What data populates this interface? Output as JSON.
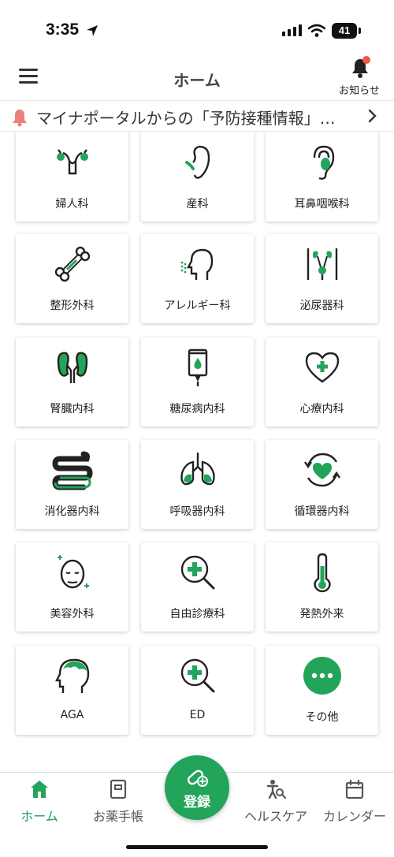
{
  "status": {
    "time": "3:35",
    "battery": "41"
  },
  "header": {
    "title": "ホーム",
    "notifications_label": "お知らせ"
  },
  "announcement": {
    "text": "マイナポータルからの「予防接種情報」…"
  },
  "categories": [
    {
      "label": "婦人科",
      "icon": "uterus-icon"
    },
    {
      "label": "産科",
      "icon": "fetus-icon"
    },
    {
      "label": "耳鼻咽喉科",
      "icon": "ear-icon"
    },
    {
      "label": "整形外科",
      "icon": "bone-icon"
    },
    {
      "label": "アレルギー科",
      "icon": "allergy-head-icon"
    },
    {
      "label": "泌尿器科",
      "icon": "kidney-bladder-icon"
    },
    {
      "label": "腎臓内科",
      "icon": "kidneys-icon"
    },
    {
      "label": "糖尿病内科",
      "icon": "iv-drip-icon"
    },
    {
      "label": "心療内科",
      "icon": "heart-cross-icon"
    },
    {
      "label": "消化器内科",
      "icon": "intestine-icon"
    },
    {
      "label": "呼吸器内科",
      "icon": "lungs-icon"
    },
    {
      "label": "循環器内科",
      "icon": "heart-circulation-icon"
    },
    {
      "label": "美容外科",
      "icon": "face-sparkle-icon"
    },
    {
      "label": "自由診療科",
      "icon": "magnifier-cross-icon"
    },
    {
      "label": "発熱外来",
      "icon": "thermometer-icon"
    },
    {
      "label": "AGA",
      "icon": "head-hair-icon"
    },
    {
      "label": "ED",
      "icon": "magnifier-cross-icon"
    },
    {
      "label": "その他",
      "icon": "more-dots-icon"
    }
  ],
  "tabs": [
    {
      "label": "ホーム",
      "icon": "home-icon",
      "active": true
    },
    {
      "label": "お薬手帳",
      "icon": "notebook-icon",
      "active": false
    },
    {
      "label": "ヘルスケア",
      "icon": "healthcare-icon",
      "active": false
    },
    {
      "label": "カレンダー",
      "icon": "calendar-icon",
      "active": false
    }
  ],
  "register": {
    "label": "登録",
    "icon": "pill-add-icon"
  },
  "colors": {
    "accent": "#22a45a",
    "notification": "#f0564a",
    "text": "#222222"
  }
}
